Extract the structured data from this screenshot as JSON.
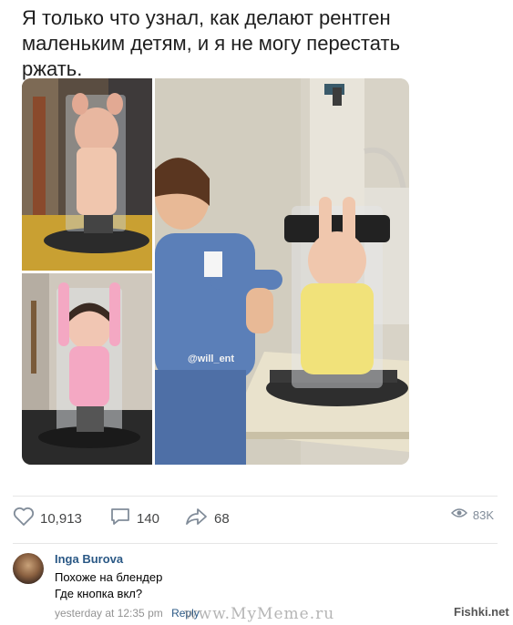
{
  "post": {
    "text": "Я только что узнал, как делают рентген маленьким детям, и я не могу перестать ржать."
  },
  "photo": {
    "watermark_user": "@will_ent"
  },
  "actions": {
    "likes": "10,913",
    "comments": "140",
    "shares": "68",
    "views": "83K",
    "icons": [
      "heart-icon",
      "comment-icon",
      "share-icon",
      "eye-icon"
    ]
  },
  "comment": {
    "author": "Inga Burova",
    "line1": "Похоже на блендер",
    "line2": "Где кнопка вкл?",
    "timestamp": "yesterday at 12:35 pm",
    "reply": "Reply"
  },
  "watermarks": {
    "site": "www.MyMeme.ru",
    "fishki": "Fishki.net"
  },
  "colors": {
    "link": "#2a5885",
    "text": "#1e1e1e",
    "muted": "#939393",
    "icon": "#818c99"
  }
}
